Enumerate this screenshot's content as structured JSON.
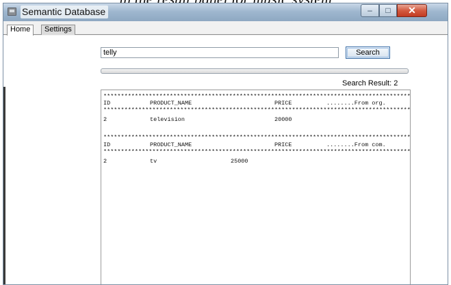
{
  "caption": "in the result panel for music system",
  "window": {
    "title": "Semantic Database",
    "minimize_glyph": "–",
    "maximize_glyph": "□",
    "close_glyph": "✕"
  },
  "tabs": [
    {
      "label": "Home",
      "selected": true
    },
    {
      "label": "Settings",
      "selected": false
    }
  ],
  "search": {
    "value": "telly",
    "button_label": "Search",
    "progress": 0
  },
  "result_count": "Search Result: 2",
  "results": {
    "separator": "**********************************************************************************************",
    "blocks": [
      {
        "headers": [
          "ID",
          "PRODUCT_NAME",
          "PRICE",
          "........From org."
        ],
        "rows": [
          [
            "2",
            "television",
            "20000"
          ]
        ]
      },
      {
        "headers": [
          "ID",
          "PRODUCT_NAME",
          "PRICE",
          "........From com."
        ],
        "rows": [
          [
            "2",
            "tv",
            "25000"
          ]
        ]
      }
    ]
  }
}
